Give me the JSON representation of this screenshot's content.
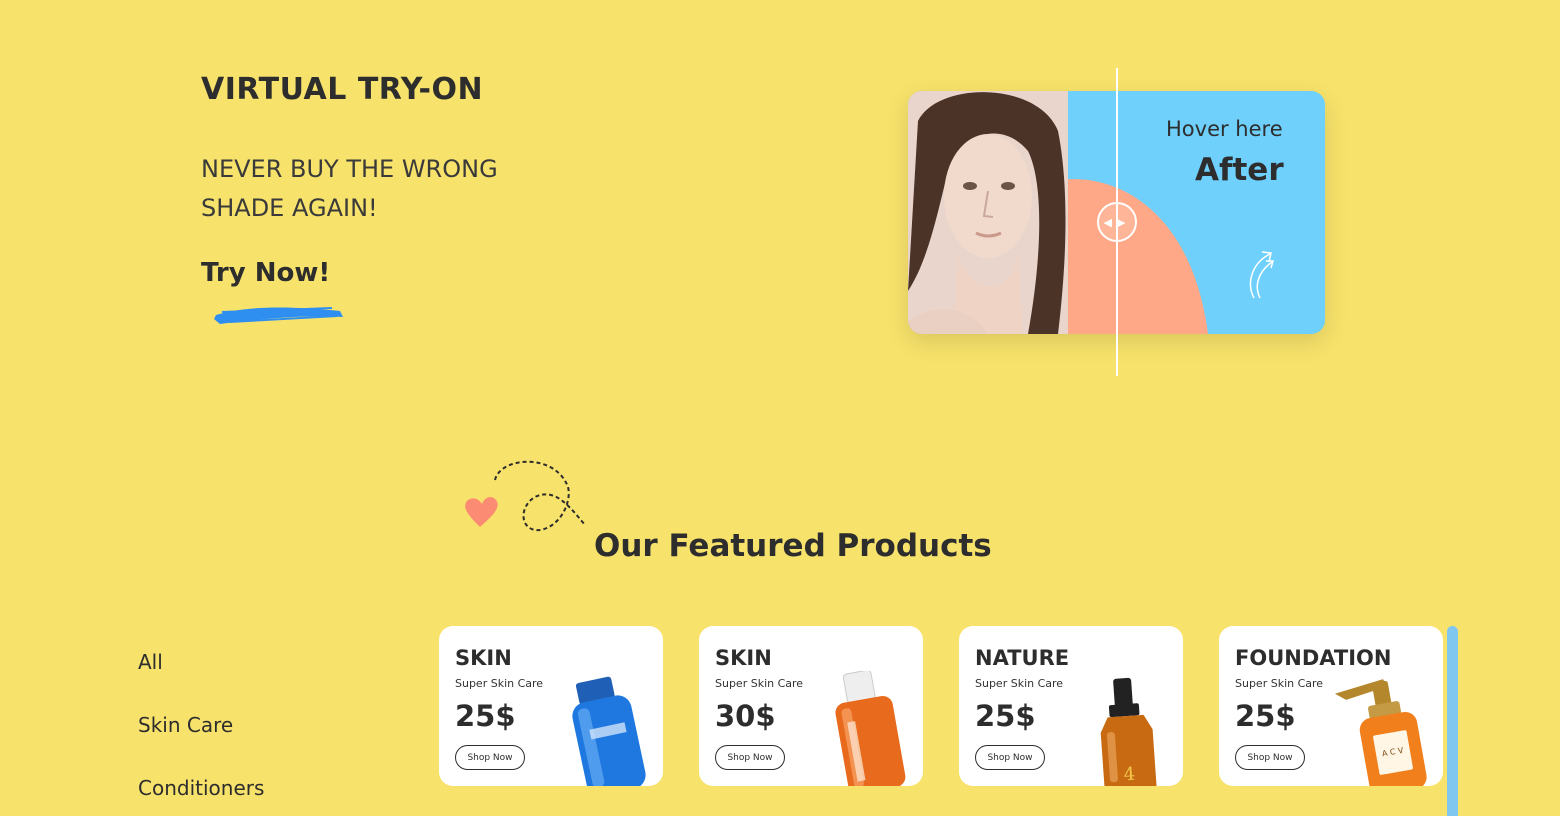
{
  "hero": {
    "title": "VIRTUAL TRY-ON",
    "subtitle": "NEVER BUY THE WRONG SHADE AGAIN!",
    "cta": "Try Now!"
  },
  "compare": {
    "hover_label": "Hover here",
    "after_label": "After"
  },
  "featured": {
    "title": "Our Featured Products",
    "categories": [
      "All",
      "Skin Care",
      "Conditioners"
    ],
    "products": [
      {
        "name": "SKIN",
        "subtitle": "Super Skin Care",
        "price": "25$",
        "button": "Shop Now"
      },
      {
        "name": "SKIN",
        "subtitle": "Super Skin Care",
        "price": "30$",
        "button": "Shop Now"
      },
      {
        "name": "NATURE",
        "subtitle": "Super Skin Care",
        "price": "25$",
        "button": "Shop Now"
      },
      {
        "name": "FOUNDATION",
        "subtitle": "Super Skin Care",
        "price": "25$",
        "button": "Shop Now"
      }
    ]
  },
  "colors": {
    "background": "#f7e26b",
    "card_blue": "#6ed0fb",
    "card_peach": "#ffa887",
    "brush_blue": "#2f8ff0",
    "heart": "#fb8c73"
  },
  "icons": [
    "slider-arrows-icon",
    "curved-arrow-icon",
    "heart-icon",
    "dashed-loop-icon",
    "brush-stroke-icon"
  ]
}
